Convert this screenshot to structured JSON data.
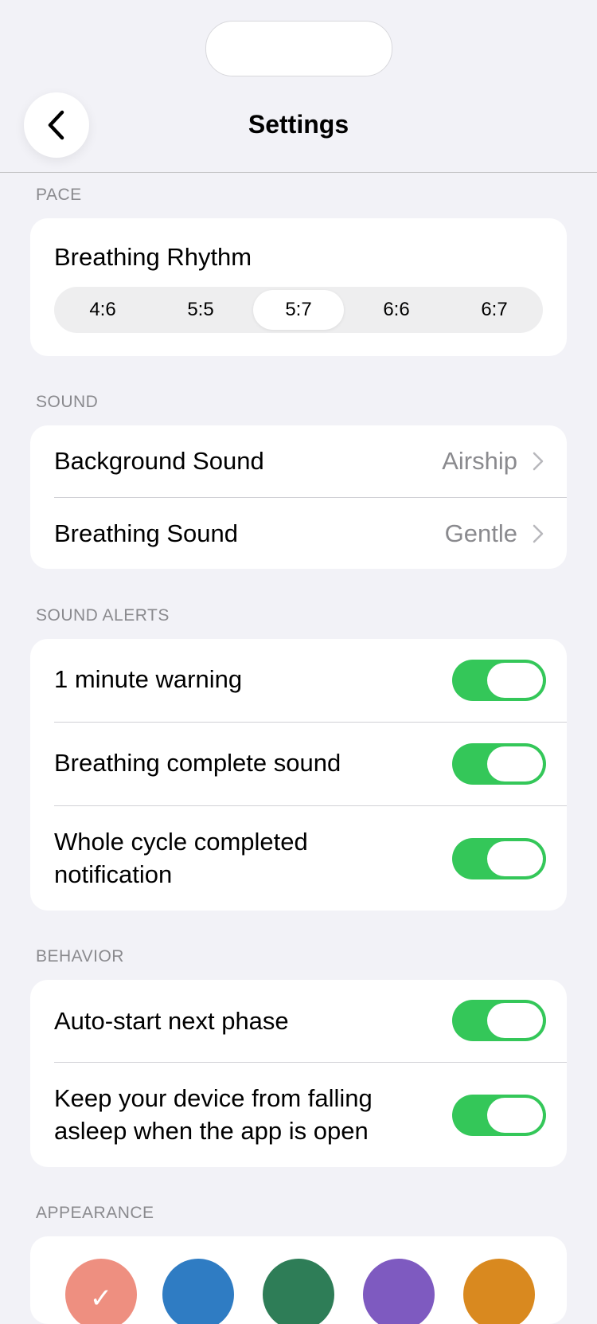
{
  "header": {
    "title": "Settings",
    "back_icon": "chevron-left-icon"
  },
  "pace": {
    "section_label": "PACE",
    "rhythm_label": "Breathing Rhythm",
    "options": [
      "4:6",
      "5:5",
      "5:7",
      "6:6",
      "6:7"
    ],
    "selected": "5:7"
  },
  "sound": {
    "section_label": "SOUND",
    "background": {
      "label": "Background Sound",
      "value": "Airship"
    },
    "breathing": {
      "label": "Breathing Sound",
      "value": "Gentle"
    }
  },
  "sound_alerts": {
    "section_label": "SOUND ALERTS",
    "items": [
      {
        "label": "1 minute warning",
        "on": true
      },
      {
        "label": "Breathing complete sound",
        "on": true
      },
      {
        "label": "Whole cycle completed notification",
        "on": true
      }
    ]
  },
  "behavior": {
    "section_label": "BEHAVIOR",
    "items": [
      {
        "label": "Auto-start next phase",
        "on": true
      },
      {
        "label": "Keep your device from falling asleep when the app is open",
        "on": true
      }
    ]
  },
  "appearance": {
    "section_label": "APPEARANCE",
    "swatches": [
      {
        "name": "coral",
        "color": "#EE8F80",
        "selected": true
      },
      {
        "name": "blue",
        "color": "#2F7CC3",
        "selected": false
      },
      {
        "name": "green",
        "color": "#2E7D57",
        "selected": false
      },
      {
        "name": "purple",
        "color": "#7E5AC0",
        "selected": false
      },
      {
        "name": "orange",
        "color": "#D9891F",
        "selected": false
      }
    ],
    "check_glyph": "✓"
  },
  "colors": {
    "toggle_on": "#34C759",
    "background": "#F2F2F7",
    "secondary_text": "#8A8A8E"
  }
}
